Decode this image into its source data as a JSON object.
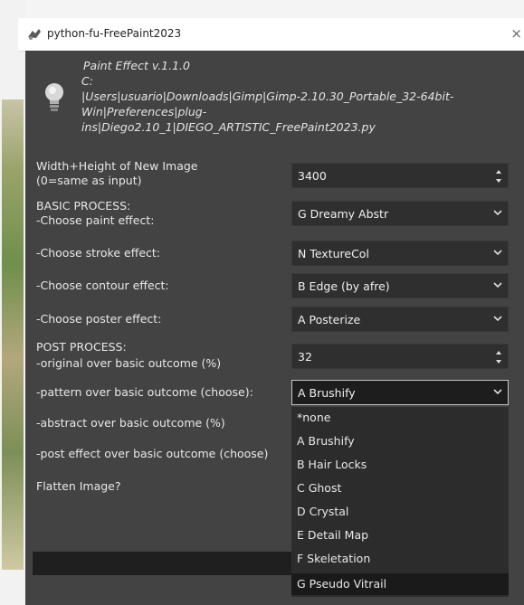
{
  "window": {
    "title": "python-fu-FreePaint2023",
    "close_glyph": "×"
  },
  "header": {
    "line1": "Paint Effect v.1.1.0",
    "line2": "C:",
    "line3": "|Users|usuario|Downloads|Gimp|Gimp-2.10.30_Portable_32-64bit-",
    "line4": "Win|Preferences|plug-",
    "line5": "ins|Diego2.10_1|DIEGO_ARTISTIC_FreePaint2023.py",
    "icon": "lightbulb-icon"
  },
  "form": {
    "width_height": {
      "label1": "Width+Height of New Image",
      "label2": " (0=same as input)",
      "value": "3400"
    },
    "basic_process": {
      "heading": "BASIC PROCESS:"
    },
    "paint_effect": {
      "label": " -Choose paint effect:",
      "value": "G Dreamy Abstr"
    },
    "stroke_effect": {
      "label": " -Choose stroke effect:",
      "value": "N TextureCol"
    },
    "contour_effect": {
      "label": " -Choose contour effect:",
      "value": "B Edge (by afre)"
    },
    "poster_effect": {
      "label": " -Choose poster effect:",
      "value": "A Posterize"
    },
    "post_process": {
      "heading": "POST PROCESS:"
    },
    "original_over": {
      "label": " -original over basic outcome (%)",
      "value": "32"
    },
    "pattern_over": {
      "label": "-pattern over basic outcome (choose):",
      "value": "A Brushify"
    },
    "abstract_over": {
      "label": "-abstract over basic outcome (%)"
    },
    "post_effect_over": {
      "label": "-post effect over basic outcome (choose)"
    },
    "flatten": {
      "label": "Flatten Image?"
    }
  },
  "dropdown_options": [
    "*none",
    "A Brushify",
    "B Hair Locks",
    "C Ghost",
    "D Crystal",
    "E Detail Map",
    "F Skeletation",
    "G Pseudo Vitrail"
  ],
  "colors": {
    "dialog_bg": "#434343",
    "field_bg": "#2f2f2f",
    "text": "#e8e8e8"
  }
}
